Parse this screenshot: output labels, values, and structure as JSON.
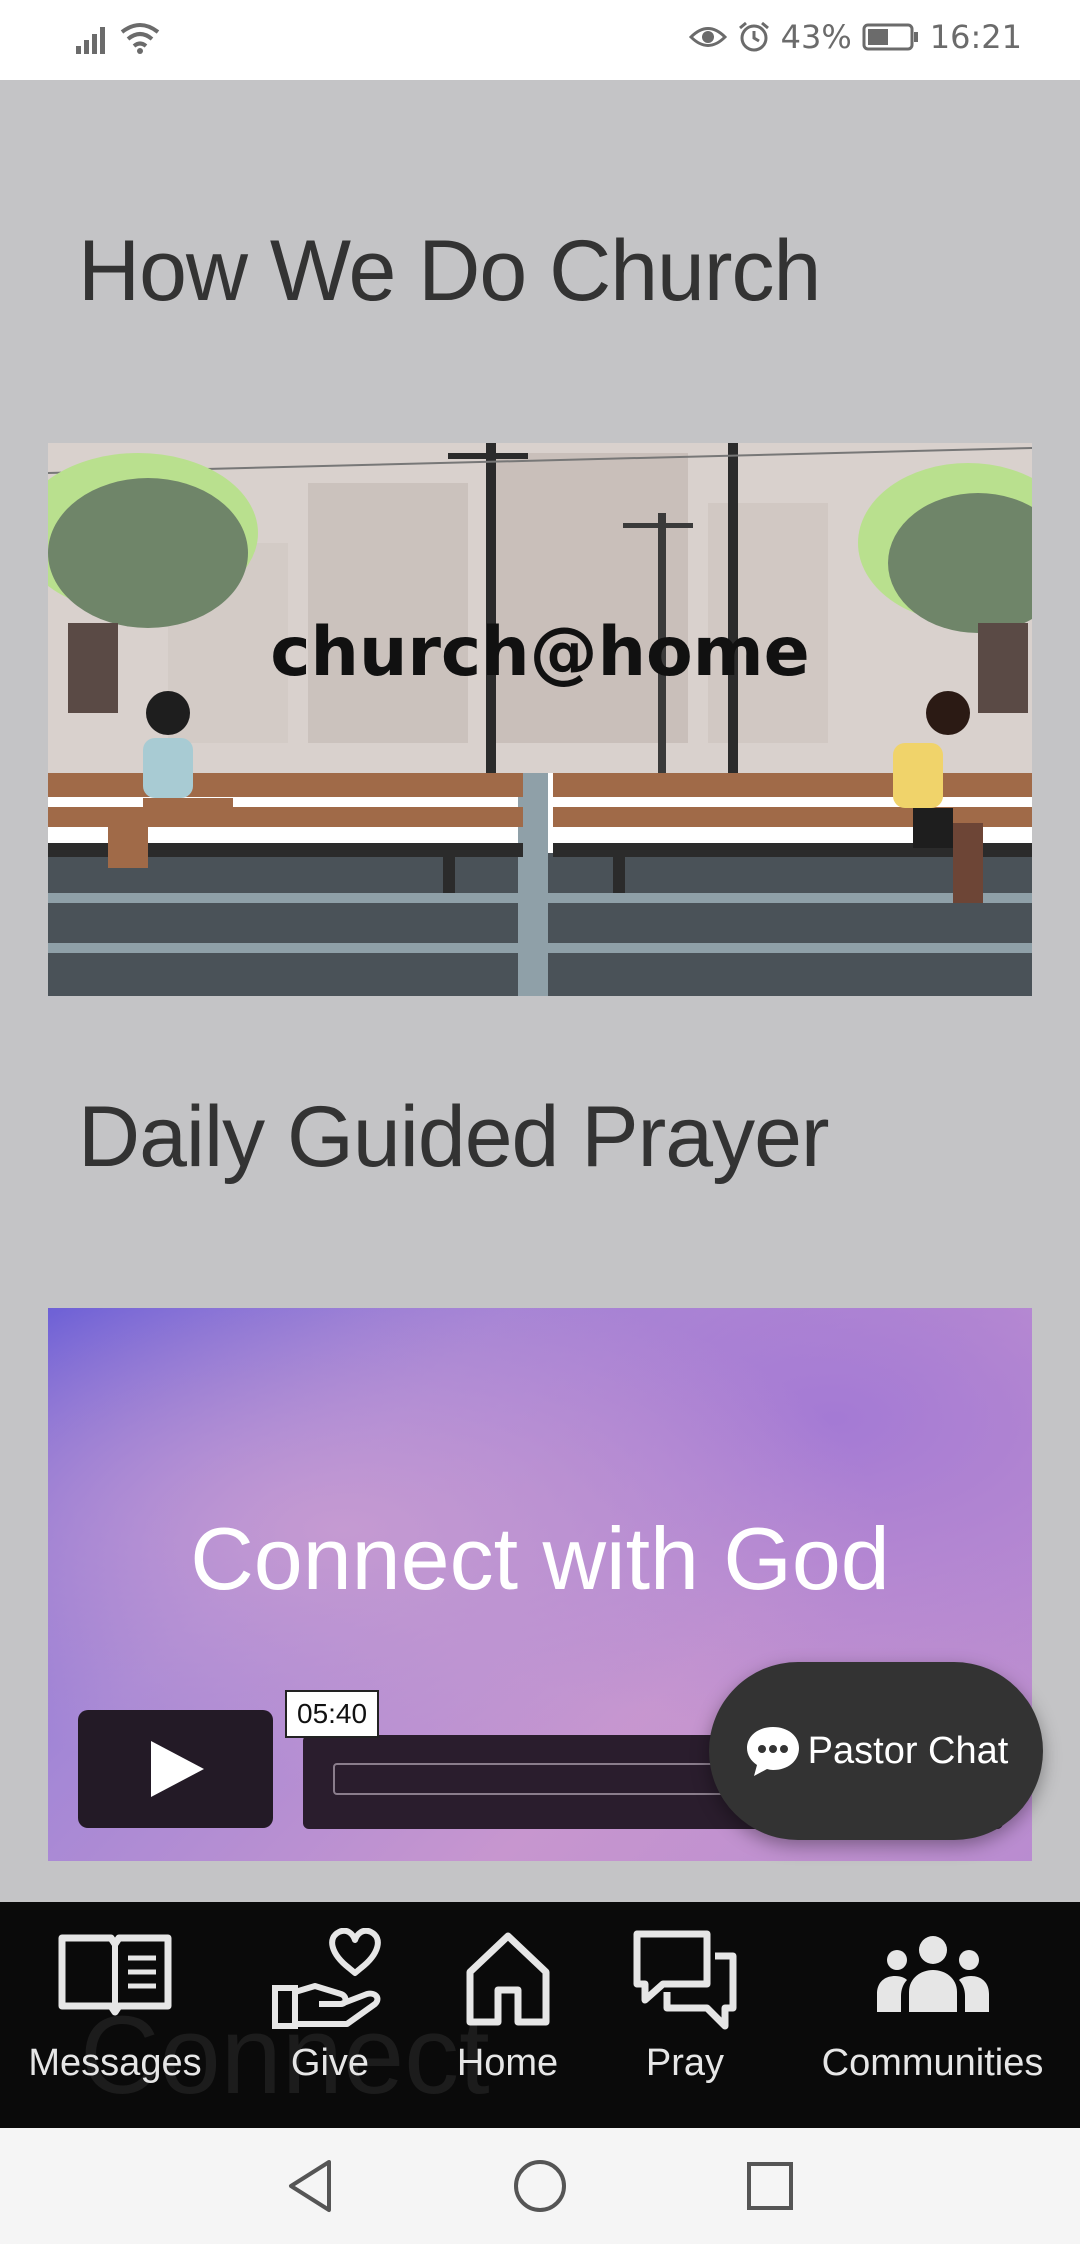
{
  "status_bar": {
    "battery": "43%",
    "time": "16:21",
    "icons": [
      "signal-icon",
      "wifi-icon",
      "eye-icon",
      "alarm-icon",
      "battery-icon"
    ]
  },
  "sections": [
    {
      "title": "How We Do Church",
      "video_text": "church@home"
    },
    {
      "title": "Daily Guided Prayer",
      "video_text": "Connect with God",
      "time_tooltip": "05:40"
    }
  ],
  "pastor_chat": {
    "label": "Pastor Chat"
  },
  "bottom_nav": {
    "ghost_text": "Connect",
    "items": [
      {
        "label": "Messages",
        "icon": "book-icon"
      },
      {
        "label": "Give",
        "icon": "hand-heart-icon"
      },
      {
        "label": "Home",
        "icon": "home-icon"
      },
      {
        "label": "Pray",
        "icon": "chat-bubbles-icon"
      },
      {
        "label": "Communities",
        "icon": "people-icon"
      }
    ]
  },
  "colors": {
    "page_bg": "#c4c4c6",
    "nav_bg": "#0a0a0a",
    "chat_bg": "#333333"
  }
}
